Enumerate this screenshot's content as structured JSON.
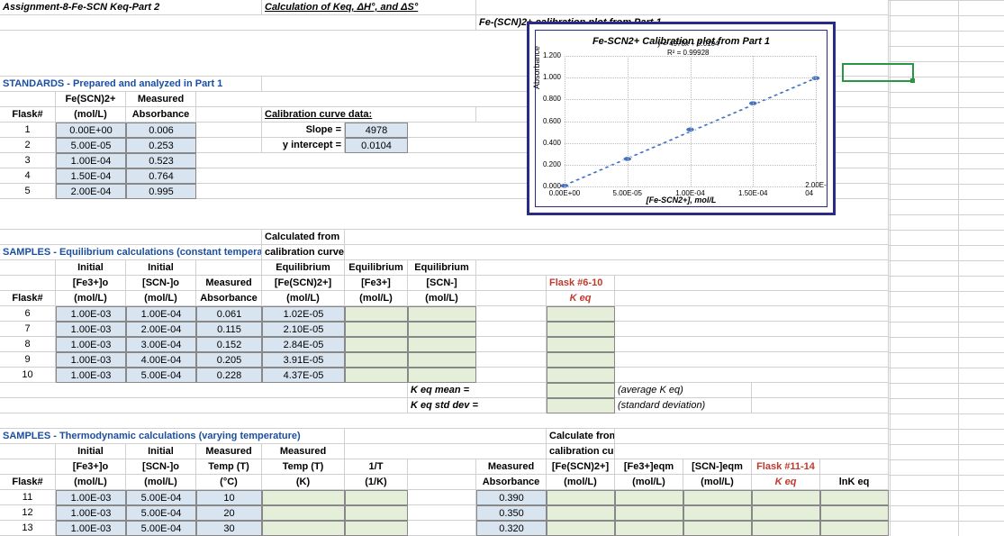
{
  "title": "Assignment-8-Fe-SCN Keq-Part 2",
  "subtitle": "Calculation of Keq,  ΔH°, and ΔS°",
  "chart_ref": "Fe-(SCN)2+ calibration plot from Part 1",
  "standards_header": "STANDARDS - Prepared and analyzed in Part 1",
  "headers": {
    "flask": "Flask#",
    "species": "Fe(SCN)2+",
    "unit_molL": "(mol/L)",
    "meas": "Measured",
    "abs": "Absorbance",
    "cal_head": "Calibration curve data:",
    "slope": "Slope =",
    "yint": "y intercept =",
    "calc_from1": "Calculated from",
    "calc_from2": "calibration curve",
    "eq_header": "Equilibrium",
    "fe3_init": "[Fe3+]o",
    "scn_init": "[SCN-]o",
    "fe_complex": "[Fe(SCN)2+]",
    "fe3": "[Fe3+]",
    "scn": "[SCN-]",
    "flask610": "Flask #6-10",
    "keq_i": "K eq",
    "initial": "Initial",
    "mean": "K eq mean =",
    "std": "K eq std dev =",
    "avg": "(average K eq)",
    "sd": "(standard deviation)",
    "tempc": "(°C)",
    "tempK": "(K)",
    "tempT": "Temp (T)",
    "invT": "1/T",
    "invTu": "(1/K)",
    "calc_from": "Calculate from",
    "fe3eqm": "[Fe3+]eqm",
    "scneqm": "[SCN-]eqm",
    "flask1114": "Flask #11-14",
    "lnK": "lnK eq"
  },
  "cal": {
    "slope": "4978",
    "yint": "0.0104"
  },
  "standards": [
    {
      "f": "1",
      "c": "0.00E+00",
      "a": "0.006"
    },
    {
      "f": "2",
      "c": "5.00E-05",
      "a": "0.253"
    },
    {
      "f": "3",
      "c": "1.00E-04",
      "a": "0.523"
    },
    {
      "f": "4",
      "c": "1.50E-04",
      "a": "0.764"
    },
    {
      "f": "5",
      "c": "2.00E-04",
      "a": "0.995"
    }
  ],
  "samples_header": "SAMPLES - Equilibrium calculations (constant temperature)",
  "samples": [
    {
      "f": "6",
      "fe": "1.00E-03",
      "scn": "1.00E-04",
      "a": "0.061",
      "eq": "1.02E-05"
    },
    {
      "f": "7",
      "fe": "1.00E-03",
      "scn": "2.00E-04",
      "a": "0.115",
      "eq": "2.10E-05"
    },
    {
      "f": "8",
      "fe": "1.00E-03",
      "scn": "3.00E-04",
      "a": "0.152",
      "eq": "2.84E-05"
    },
    {
      "f": "9",
      "fe": "1.00E-03",
      "scn": "4.00E-04",
      "a": "0.205",
      "eq": "3.91E-05"
    },
    {
      "f": "10",
      "fe": "1.00E-03",
      "scn": "5.00E-04",
      "a": "0.228",
      "eq": "4.37E-05"
    }
  ],
  "thermo_header": "SAMPLES - Thermodynamic calculations (varying temperature)",
  "thermo": [
    {
      "f": "11",
      "fe": "1.00E-03",
      "scn": "5.00E-04",
      "t": "10",
      "a": "0.390"
    },
    {
      "f": "12",
      "fe": "1.00E-03",
      "scn": "5.00E-04",
      "t": "20",
      "a": "0.350"
    },
    {
      "f": "13",
      "fe": "1.00E-03",
      "scn": "5.00E-04",
      "t": "30",
      "a": "0.320"
    }
  ],
  "chart_data": {
    "type": "scatter",
    "title": "Fe-SCN2+ Calibration plot from Part 1",
    "xlabel": "[Fe-SCN2+], mol/L",
    "ylabel": "Absorbance",
    "xlim": [
      0,
      0.0002
    ],
    "ylim": [
      0,
      1.2
    ],
    "xticks": [
      "0.00E+00",
      "5.00E-05",
      "1.00E-04",
      "1.50E-04",
      "2.00E-04"
    ],
    "yticks": [
      "0.000",
      "0.200",
      "0.400",
      "0.600",
      "0.800",
      "1.000",
      "1.200"
    ],
    "equation": "y = 4978x + 0.0104",
    "r2": "R² = 0.99928",
    "series": [
      {
        "name": "Absorbance",
        "x": [
          0,
          5e-05,
          0.0001,
          0.00015,
          0.0002
        ],
        "y": [
          0.006,
          0.253,
          0.523,
          0.764,
          0.995
        ]
      }
    ]
  }
}
